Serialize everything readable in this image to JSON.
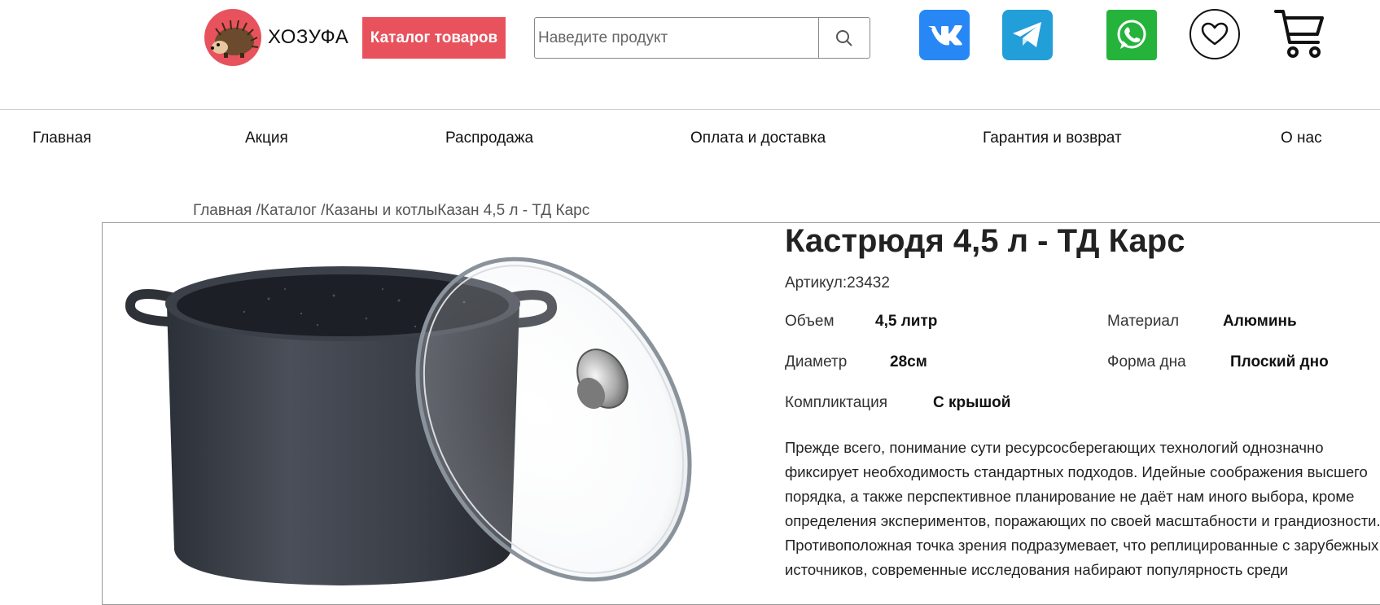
{
  "header": {
    "logo_text": "ХОЗУФА",
    "catalog_button": "Каталог товаров",
    "search_placeholder": "Наведите продукт",
    "icons": [
      "search-icon",
      "vk-icon",
      "telegram-icon",
      "whatsapp-icon",
      "heart-icon",
      "cart-icon"
    ]
  },
  "nav": {
    "items": [
      "Главная",
      "Акция",
      "Распродажа",
      "Оплата и доставка",
      "Гарантия и возврат",
      "О нас"
    ]
  },
  "breadcrumb": {
    "home": "Главная /",
    "catalog": "Каталог /",
    "category": "Казаны и котлы",
    "current": "Казан 4,5 л - ТД Карс"
  },
  "product": {
    "title": "Кастрюдя 4,5 л - ТД Карс",
    "sku": "Артикул:23432",
    "specs": {
      "volume_label": "Объем",
      "volume_value": "4,5 литр",
      "material_label": "Материал",
      "material_value": "Алюминь",
      "diameter_label": "Диаметр",
      "diameter_value": "28см",
      "bottom_label": "Форма дна",
      "bottom_value": "Плоский дно",
      "set_label": "Компликтация",
      "set_value": "С крышой"
    },
    "description_lines": [
      "Прежде всего, понимание сути ресурсосберегающих технологий однозначно",
      "фиксирует необходимость стандартных подходов. Идейные соображения высшего",
      "порядка, а также перспективное планирование не даёт нам иного выбора, кроме",
      "определения экспериментов, поражающих по своей масштабности и грандиозности.",
      "Противоположная точка зрения подразумевает, что реплицированные с зарубежных",
      "источников, современные исследования набирают популярность среди"
    ]
  },
  "colors": {
    "accent": "#e8525d",
    "vk": "#2787f5",
    "telegram": "#229ed9",
    "whatsapp": "#25b33b"
  }
}
